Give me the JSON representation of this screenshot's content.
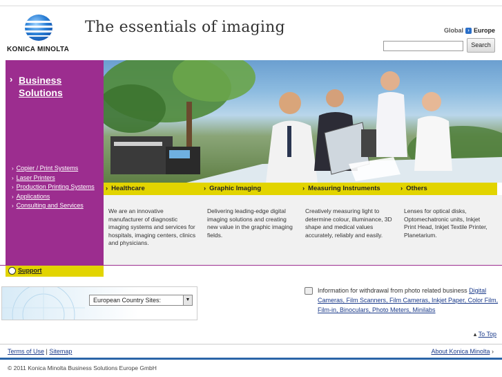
{
  "header": {
    "brand": "KONICA MINOLTA",
    "tagline": "The essentials of imaging",
    "region_label": "Global",
    "region_current": "Europe",
    "search_value": "",
    "search_button": "Search"
  },
  "sidebar": {
    "title": "Business Solutions",
    "links": [
      {
        "label": "Copier / Print Systems"
      },
      {
        "label": "Laser Printers"
      },
      {
        "label": "Production Printing Systems"
      },
      {
        "label": "Applications"
      },
      {
        "label": "Consulting and Services"
      }
    ],
    "support_label": "Support"
  },
  "categories": [
    {
      "label": "Healthcare",
      "description": "We are an innovative manufacturer of diagnostic imaging systems and services for hospitals, imaging centers, clinics and physicians."
    },
    {
      "label": "Graphic Imaging",
      "description": "Delivering leading-edge digital imaging solutions and creating new value in the graphic imaging fields."
    },
    {
      "label": "Measuring Instruments",
      "description": "Creatively measuring light to determine colour, illuminance, 3D shape and medical values accurately, reliably and easily."
    },
    {
      "label": "Others",
      "description": "Lenses for optical disks, Optomechatronic units, Inkjet Print Head, Inkjet Textile Printer, Planetarium."
    }
  ],
  "country_select": {
    "value": "European Country Sites:"
  },
  "notice": {
    "intro": "Information for withdrawal from photo related business",
    "link": "Digital Cameras, Film Scanners, Film Cameras, Inkjet Paper, Color Film, Film-in, Binoculars, Photo Meters, Minilabs"
  },
  "to_top": "To Top",
  "footer": {
    "terms": "Terms of Use",
    "separator": "|",
    "sitemap": "Sitemap",
    "about": "About Konica Minolta",
    "copyright": "© 2011 Konica Minolta Business Solutions Europe GmbH"
  },
  "colors": {
    "sidebar_purple": "#9c2d8f",
    "accent_yellow": "#e2d400",
    "link_blue": "#1a3a8a",
    "footer_blue": "#2a64a8"
  },
  "icons": {
    "region": "arrow-right-icon",
    "support": "lifebuoy-icon",
    "notice": "camera-icon"
  }
}
